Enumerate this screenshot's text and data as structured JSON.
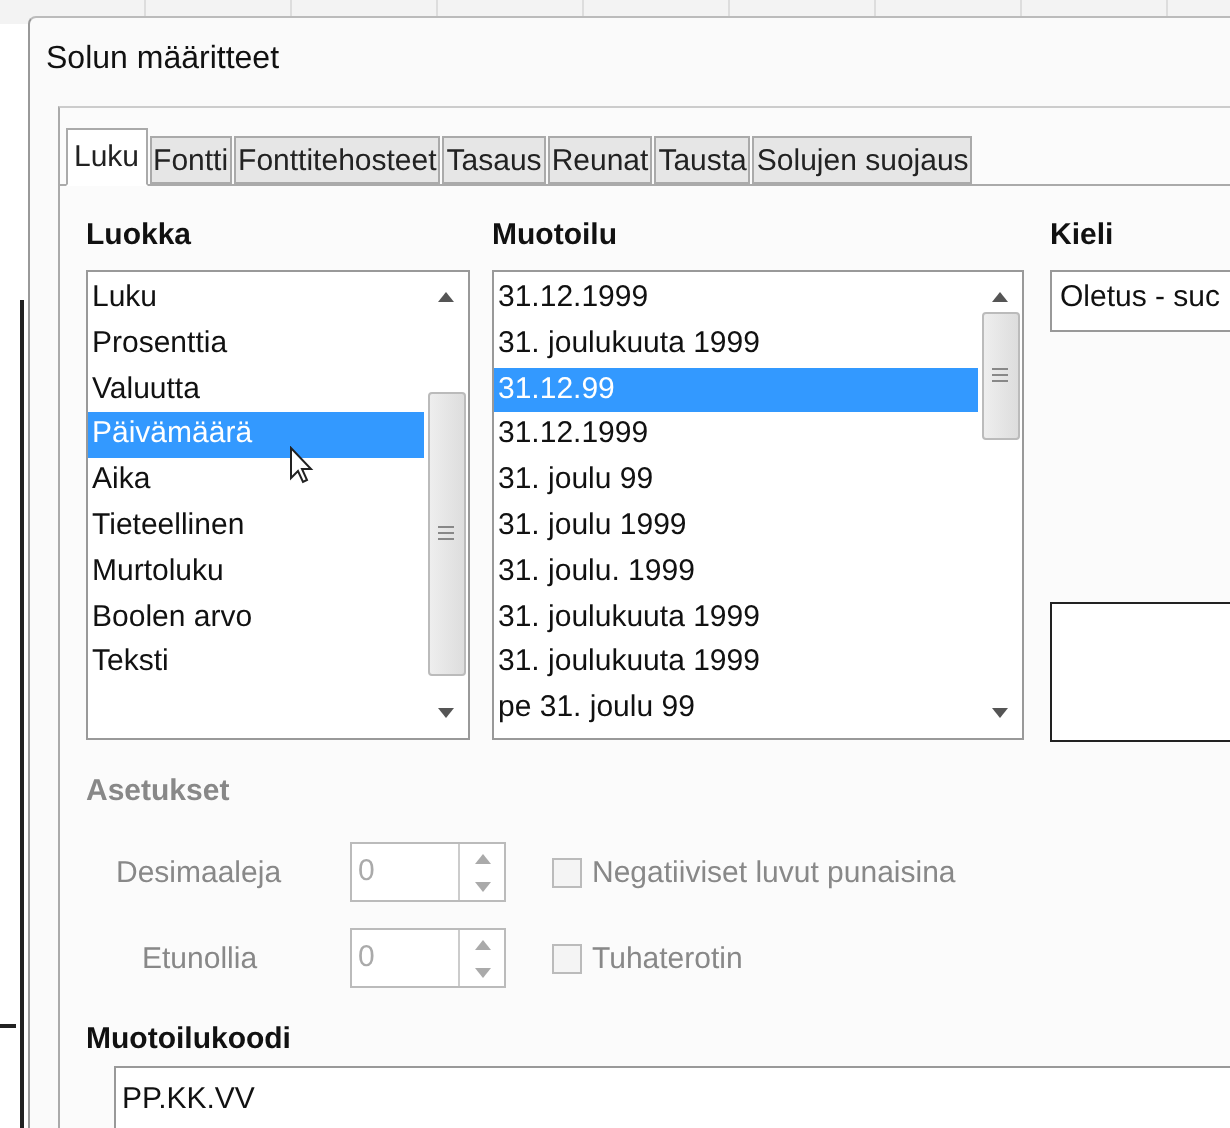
{
  "window": {
    "title": "Solun määritteet"
  },
  "tabs": [
    {
      "label": "Luku",
      "selected": true
    },
    {
      "label": "Fontti",
      "selected": false
    },
    {
      "label": "Fonttitehosteet",
      "selected": false
    },
    {
      "label": "Tasaus",
      "selected": false
    },
    {
      "label": "Reunat",
      "selected": false
    },
    {
      "label": "Tausta",
      "selected": false
    },
    {
      "label": "Solujen suojaus",
      "selected": false
    }
  ],
  "category": {
    "label": "Luokka",
    "items": [
      {
        "label": "Luku",
        "selected": false
      },
      {
        "label": "Prosenttia",
        "selected": false
      },
      {
        "label": "Valuutta",
        "selected": false
      },
      {
        "label": "Päivämäärä",
        "selected": true
      },
      {
        "label": "Aika",
        "selected": false
      },
      {
        "label": "Tieteellinen",
        "selected": false
      },
      {
        "label": "Murtoluku",
        "selected": false
      },
      {
        "label": "Boolen arvo",
        "selected": false
      },
      {
        "label": "Teksti",
        "selected": false
      }
    ]
  },
  "format": {
    "label": "Muotoilu",
    "items": [
      {
        "label": "31.12.1999",
        "selected": false
      },
      {
        "label": "31. joulukuuta 1999",
        "selected": false
      },
      {
        "label": "31.12.99",
        "selected": true
      },
      {
        "label": "31.12.1999",
        "selected": false
      },
      {
        "label": "31. joulu 99",
        "selected": false
      },
      {
        "label": "31. joulu 1999",
        "selected": false
      },
      {
        "label": "31. joulu. 1999",
        "selected": false
      },
      {
        "label": "31. joulukuuta 1999",
        "selected": false
      },
      {
        "label": "31. joulukuuta 1999",
        "selected": false
      },
      {
        "label": "pe 31. joulu 99",
        "selected": false
      }
    ]
  },
  "language": {
    "label": "Kieli",
    "value": "Oletus - suc"
  },
  "options": {
    "label": "Asetukset",
    "disabled": true,
    "spinners": [
      {
        "label": "Desimaaleja",
        "value": "0",
        "disabled": true
      },
      {
        "label": "Etunollia",
        "value": "0",
        "disabled": true
      }
    ],
    "checkboxes": [
      {
        "label": "Negatiiviset luvut punaisina",
        "checked": false,
        "disabled": true
      },
      {
        "label": "Tuhaterotin",
        "checked": false,
        "disabled": true
      }
    ]
  },
  "format_code": {
    "label": "Muotoilukoodi",
    "value": "PP.KK.VV"
  }
}
